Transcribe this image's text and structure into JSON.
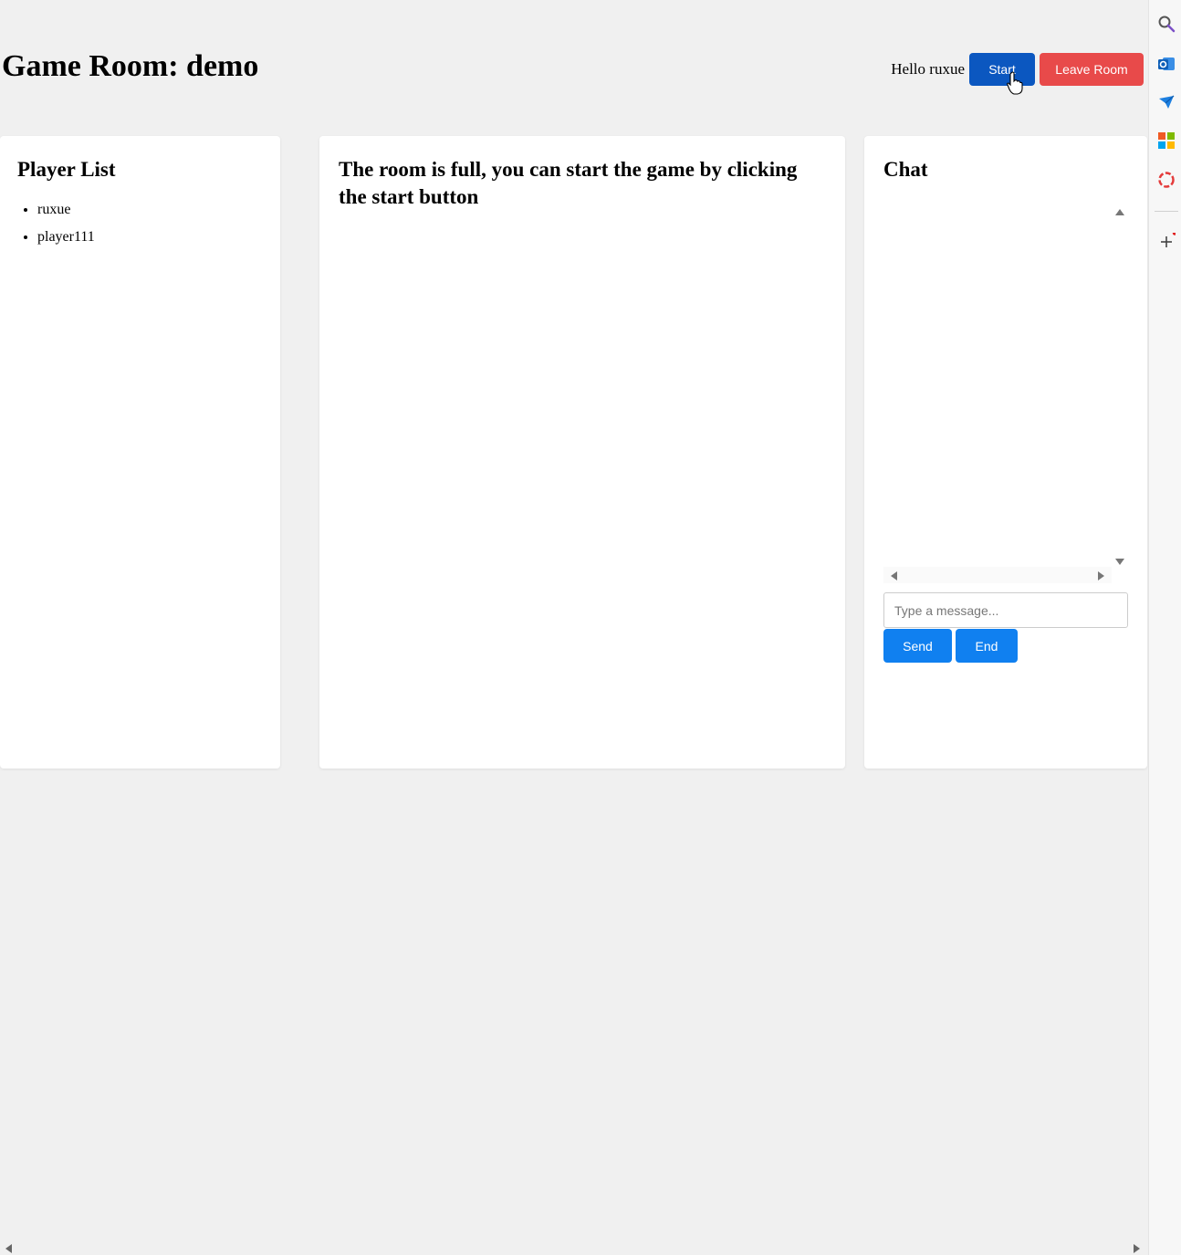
{
  "header": {
    "title": "Game Room: demo",
    "greeting": "Hello ruxue",
    "start_label": "Start",
    "leave_label": "Leave Room"
  },
  "players": {
    "heading": "Player List",
    "items": [
      "ruxue",
      "player111"
    ]
  },
  "main": {
    "message": "The room is full, you can start the game by clicking the start button"
  },
  "chat": {
    "heading": "Chat",
    "input_placeholder": "Type a message...",
    "send_label": "Send",
    "end_label": "End"
  },
  "sidebar_icons": [
    "search-icon",
    "outlook-icon",
    "send-icon",
    "office-icon",
    "circle-app-icon",
    "add-icon"
  ],
  "colors": {
    "start_button": "#0b57c0",
    "leave_button": "#e84a4a",
    "chat_buttons": "#1080f0",
    "background": "#f0f0f0"
  }
}
